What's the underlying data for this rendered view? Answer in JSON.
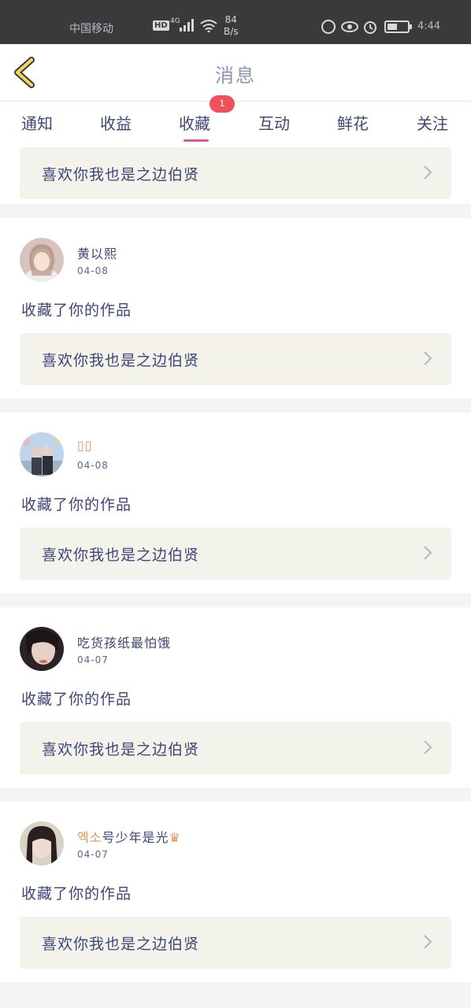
{
  "status_bar": {
    "carrier": "中国移动",
    "hd": "HD",
    "network": "4G",
    "speed_value": "84",
    "speed_unit": "B/s",
    "time": "4:44"
  },
  "header": {
    "title": "消息"
  },
  "tabs": [
    {
      "label": "通知"
    },
    {
      "label": "收益"
    },
    {
      "label": "收藏",
      "active": true,
      "badge": "1"
    },
    {
      "label": "互动"
    },
    {
      "label": "鲜花"
    },
    {
      "label": "关注"
    }
  ],
  "partial_card": {
    "work_title": "喜欢你我也是之边伯贤"
  },
  "notifications": [
    {
      "username": "黄以熙",
      "date": "04-08",
      "action": "收藏了你的作品",
      "work_title": "喜欢你我也是之边伯贤"
    },
    {
      "username": "▯▯",
      "date": "04-08",
      "action": "收藏了你的作品",
      "work_title": "喜欢你我也是之边伯贤"
    },
    {
      "username": "吃货孩纸最怕饿",
      "date": "04-07",
      "action": "收藏了你的作品",
      "work_title": "喜欢你我也是之边伯贤"
    },
    {
      "username_prefix": "엑소",
      "username_rest": "号少年是光",
      "username_suffix": "♛",
      "date": "04-07",
      "action": "收藏了你的作品",
      "work_title": "喜欢你我也是之边伯贤"
    }
  ],
  "colors": {
    "accent_underline": "#e05a9b",
    "badge": "#f0505a",
    "text": "#3d4677",
    "work_box": "#f3f3ec",
    "back_arrow": "#f0d85a"
  }
}
